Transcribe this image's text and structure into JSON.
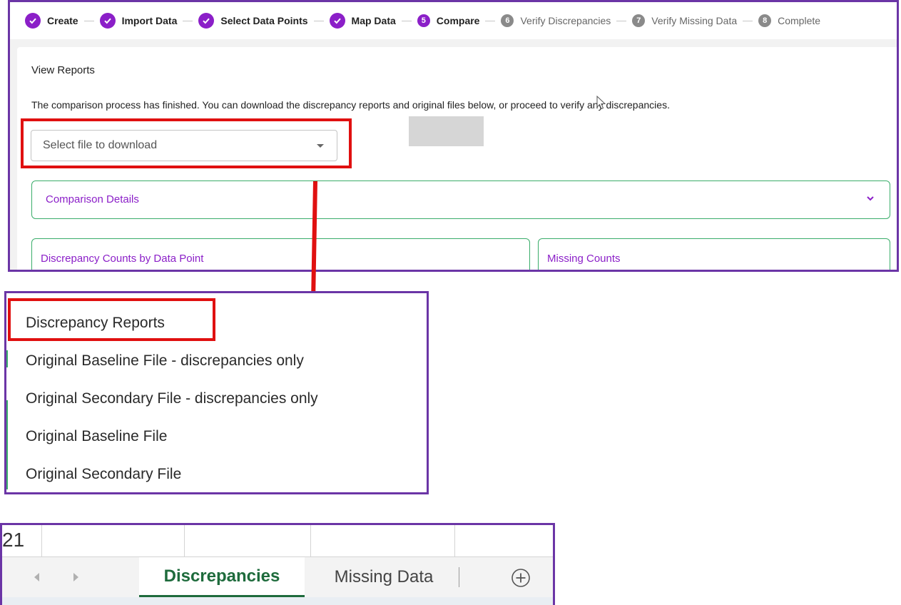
{
  "stepper": {
    "steps": [
      {
        "num": "",
        "label": "Create",
        "state": "done"
      },
      {
        "num": "",
        "label": "Import Data",
        "state": "done"
      },
      {
        "num": "",
        "label": "Select Data Points",
        "state": "done"
      },
      {
        "num": "",
        "label": "Map Data",
        "state": "done"
      },
      {
        "num": "5",
        "label": "Compare",
        "state": "active"
      },
      {
        "num": "6",
        "label": "Verify Discrepancies",
        "state": "pending"
      },
      {
        "num": "7",
        "label": "Verify Missing Data",
        "state": "pending"
      },
      {
        "num": "8",
        "label": "Complete",
        "state": "pending"
      }
    ]
  },
  "main": {
    "title": "View Reports",
    "info_text": "The comparison process has finished. You can download the discrepancy reports and original files below, or proceed to verify any discrepancies.",
    "file_select_placeholder": "Select file to download",
    "comparison_details_label": "Comparison Details",
    "discrepancy_counts_label": "Discrepancy Counts by Data Point",
    "missing_counts_label": "Missing Counts"
  },
  "dropdown": {
    "options": [
      "Discrepancy Reports",
      "Original Baseline File - discrepancies only",
      "Original Secondary File - discrepancies only",
      "Original Baseline File",
      "Original Secondary File"
    ]
  },
  "spreadsheet": {
    "row_number": "21",
    "tabs": [
      {
        "label": "Discrepancies",
        "active": true
      },
      {
        "label": "Missing Data",
        "active": false
      }
    ],
    "add_sheet_icon": "plus-circle-icon"
  },
  "colors": {
    "accent_purple": "#8b1fc8",
    "panel_border": "#6b35a6",
    "highlight_red": "#e01010",
    "card_border_green": "#3aad6a",
    "excel_green": "#1e6b3c"
  }
}
